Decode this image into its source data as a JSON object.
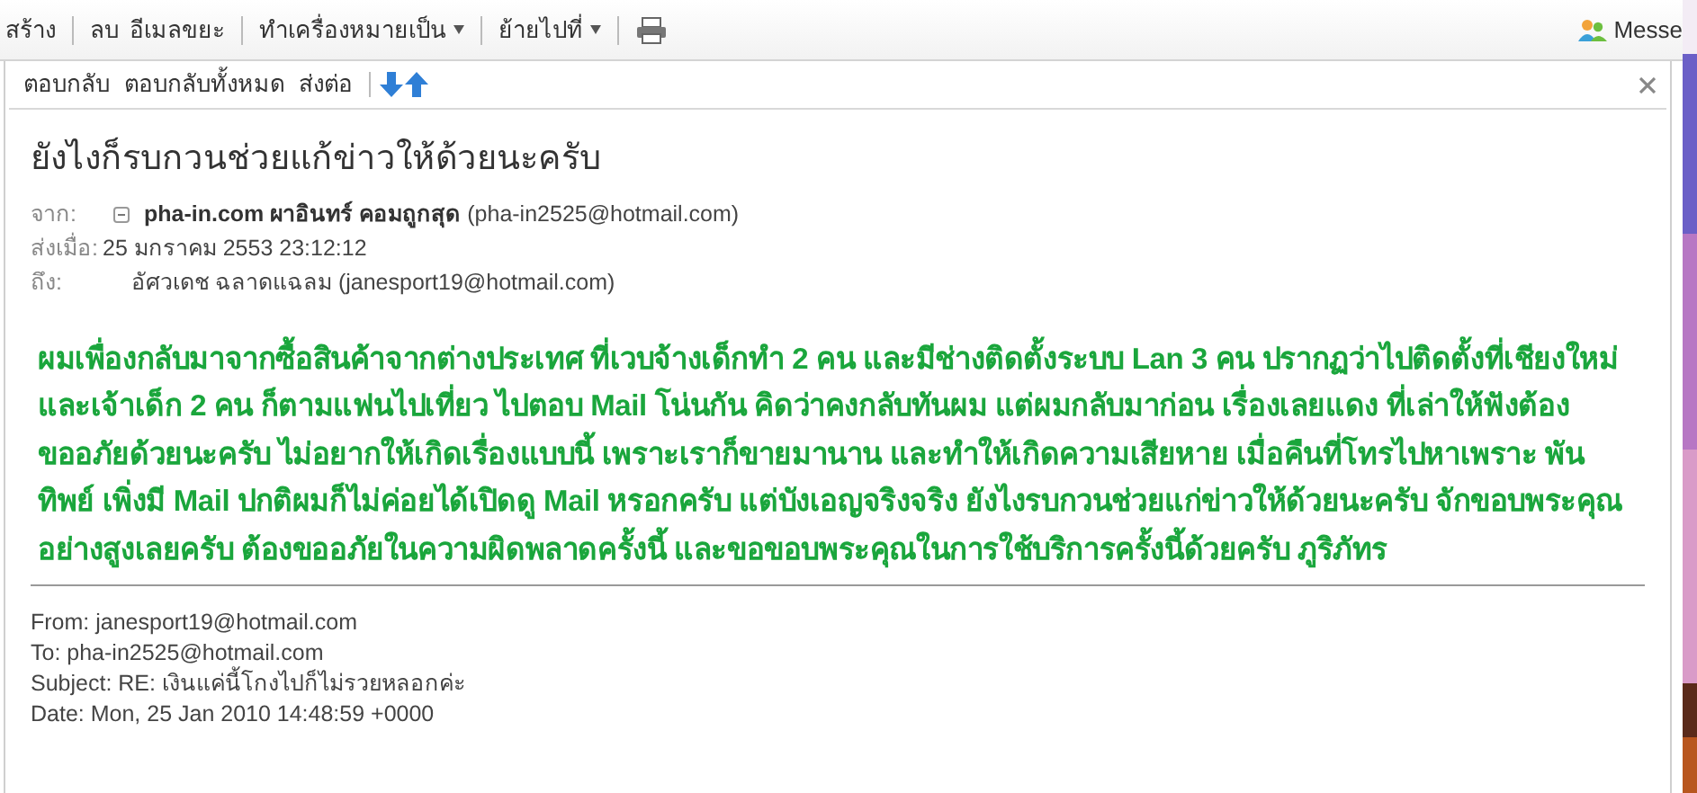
{
  "toolbar": {
    "items": [
      {
        "kind": "button",
        "label": "สร้าง"
      },
      {
        "kind": "button",
        "label": "ลบ"
      },
      {
        "kind": "button",
        "label": "อีเมลขยะ"
      },
      {
        "kind": "menu",
        "label": "ทำเครื่องหมายเป็น"
      },
      {
        "kind": "menu",
        "label": "ย้ายไปที่"
      },
      {
        "kind": "print"
      }
    ],
    "messenger": "Messe"
  },
  "message_toolbar": {
    "buttons": [
      "ตอบกลับ",
      "ตอบกลับทั้งหมด",
      "ส่งต่อ"
    ]
  },
  "message": {
    "subject": "ยังไงก็รบกวนช่วยแก้ข่าวให้ด้วยนะครับ",
    "from_label": "จาก:",
    "from_name": "pha-in.com ผาอินทร์ คอมถูกสุด",
    "from_email": "(pha-in2525@hotmail.com)",
    "sent_label": "ส่งเมื่อ:",
    "sent": "25 มกราคม 2553 23:12:12",
    "to_label": "ถึง:",
    "to": "อัศวเดช ฉลาดแฉลม (janesport19@hotmail.com)",
    "body": "ผมเพื่องกลับมาจากซื้อสินค้าจากต่างประเทศ ที่เวบจ้างเด็กทำ 2 คน และมีช่างติดตั้งระบบ Lan 3 คน ปรากฏว่าไปติดตั้งที่เชียงใหม่ และเจ้าเด็ก 2 คน ก็ตามแฟนไปเที่ยว ไปตอบ Mail โน่นกัน คิดว่าคงกลับทันผม แต่ผมกลับมาก่อน เรื่องเลยแดง ที่เล่าให้ฟังต้องขออภัยด้วยนะครับ ไม่อยากให้เกิดเรื่องแบบนี้ เพราะเราก็ขายมานาน  และทำให้เกิดความเสียหาย เมื่อคืนที่โทรไปหาเพราะ พันทิพย์ เพิ่งมี Mail ปกติผมก็ไม่ค่อยได้เปิดดู Mail หรอกครับ แต่บังเอญจริงจริง ยังไงรบกวนช่วยแก่ข่าวให้ด้วยนะครับ จักขอบพระคุณอย่างสูงเลยครับ ต้องขออภัยในความผิดพลาดครั้งนี้ และขอขอบพระคุณในการใช้บริการครั้งนี้ด้วยครับ ภูริภัทร",
    "quoted": [
      "From: janesport19@hotmail.com",
      "To: pha-in2525@hotmail.com",
      "Subject: RE: เงินแค่นี้โกงไปก็ไม่รวยหลอกค่ะ",
      "Date: Mon, 25 Jan 2010 14:48:59 +0000"
    ]
  }
}
